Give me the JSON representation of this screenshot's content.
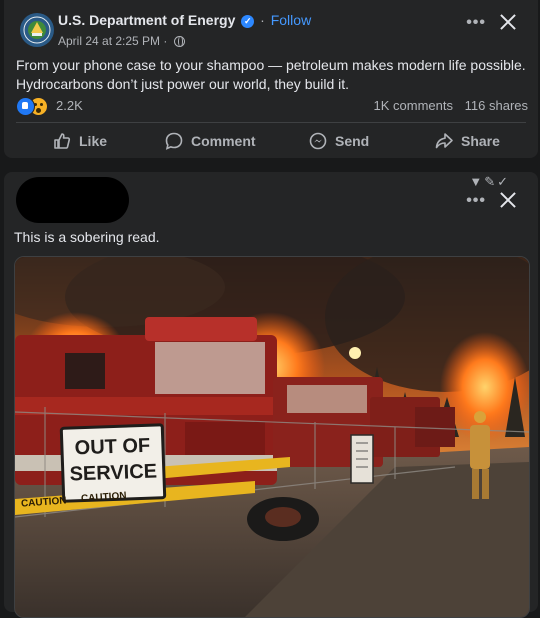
{
  "post1": {
    "page_name": "U.S. Department of Energy",
    "follow_label": "Follow",
    "date": "April 24 at 2:25 PM",
    "text_line1": "From your phone case to your shampoo — petroleum makes modern life possible.",
    "text_line2": "Hydrocarbons don’t just power our world, they build it.",
    "reaction_count": "2.2K",
    "comments": "1K comments",
    "shares": "116 shares",
    "actions": {
      "like": "Like",
      "comment": "Comment",
      "send": "Send",
      "share": "Share"
    }
  },
  "post2": {
    "text": "This is a sobering read.",
    "image": {
      "sign_line1": "OUT OF",
      "sign_line2": "SERVICE",
      "caution_tape": "CAUTION"
    }
  },
  "colors": {
    "background": "#18191a",
    "card": "#242526",
    "text_primary": "#e4e6eb",
    "text_secondary": "#b0b3b8",
    "link_blue": "#4599ff",
    "like_blue": "#2078f4"
  },
  "icons": [
    "energy-seal-icon",
    "verified-badge-icon",
    "globe-icon",
    "more-icon",
    "close-icon",
    "like-reaction-icon",
    "wow-reaction-icon",
    "thumbs-up-icon",
    "comment-icon",
    "messenger-icon",
    "share-icon",
    "filter-icon",
    "wrench-icon",
    "check-icon"
  ]
}
